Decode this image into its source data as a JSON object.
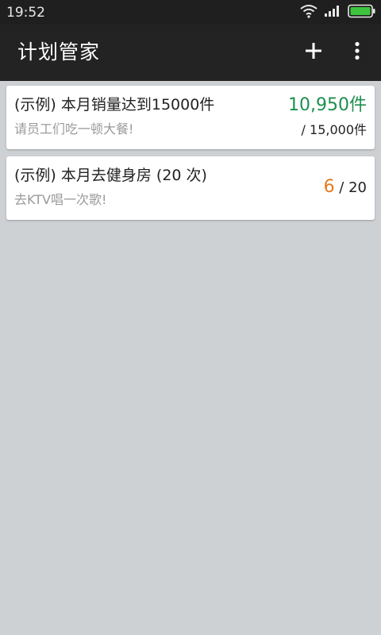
{
  "status_bar": {
    "time": "19:52",
    "icons": [
      "wifi-icon",
      "signal-icon",
      "battery-icon"
    ]
  },
  "app_bar": {
    "title": "计划管家",
    "actions": [
      "add-icon",
      "more-vert-icon"
    ]
  },
  "plans": [
    {
      "title": "(示例) 本月销量达到15000件",
      "subtitle": "请员工们吃一顿大餐!",
      "current": "10,950件",
      "target": "/ 15,000件",
      "current_color": "#1e8f4e"
    },
    {
      "title": "(示例) 本月去健身房 (20 次)",
      "subtitle": "去KTV唱一次歌!",
      "current": "6",
      "target": "/ 20",
      "current_color": "#e8791e"
    }
  ],
  "colors": {
    "app_bar": "#232323",
    "status_bar": "#1f1f1f",
    "background": "#cdd1d4",
    "battery": "#3ec43e"
  }
}
